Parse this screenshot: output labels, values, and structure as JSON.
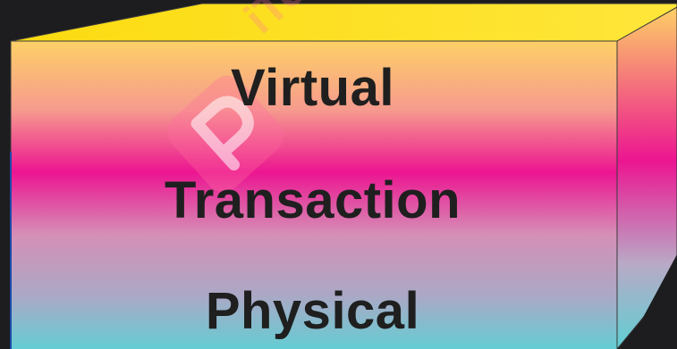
{
  "layers": [
    {
      "label": "Virtual"
    },
    {
      "label": "Transaction"
    },
    {
      "label": "Physical"
    }
  ],
  "watermark": {
    "logo_letter": "P",
    "text": "iTop"
  },
  "colors": {
    "background": "#1d1d1f",
    "front_top": "#fdd066",
    "front_mid": "#ec1591",
    "front_bottom": "#5ed0d4",
    "top_face": "#fbe215",
    "text": "#1f1f1f"
  }
}
